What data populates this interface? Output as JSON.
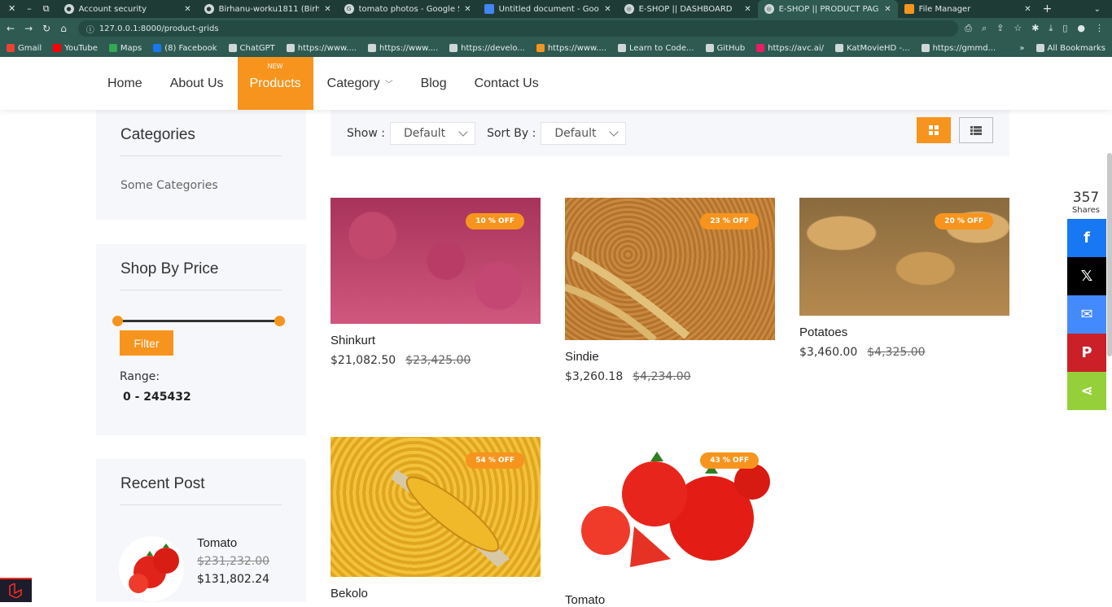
{
  "browser": {
    "tabs": [
      {
        "title": "Account security",
        "active": false
      },
      {
        "title": "Birhanu-worku1811 (Birh",
        "active": false
      },
      {
        "title": "tomato photos - Google S",
        "active": false
      },
      {
        "title": "Untitled document - Goo",
        "active": false
      },
      {
        "title": "E-SHOP || DASHBOARD",
        "active": false
      },
      {
        "title": "E-SHOP || PRODUCT PAGE",
        "active": true
      },
      {
        "title": "File Manager",
        "active": false
      }
    ],
    "url": "127.0.0.1:8000/product-grids",
    "bookmarks": [
      "Gmail",
      "YouTube",
      "Maps",
      "(8) Facebook",
      "ChatGPT",
      "https://www....",
      "https://www....",
      "https://develo...",
      "https://www....",
      "Learn to Code...",
      "GitHub",
      "https://avc.ai/",
      "KatMovieHD -...",
      "https://gmmd..."
    ],
    "all_bookmarks": "All Bookmarks"
  },
  "nav": {
    "items": [
      "Home",
      "About Us",
      "Products",
      "Category",
      "Blog",
      "Contact Us"
    ],
    "new_badge": "NEW"
  },
  "sidebar": {
    "categories_title": "Categories",
    "categories_text": "Some Categories",
    "price_title": "Shop By Price",
    "filter_label": "Filter",
    "range_label": "Range:",
    "range_value": "0  -  245432",
    "recent_title": "Recent Post",
    "recent": {
      "name": "Tomato",
      "old_price": "$231,232.00",
      "new_price": "$131,802.24"
    }
  },
  "toolbar": {
    "show_label": "Show :",
    "show_value": "Default",
    "sort_label": "Sort By :",
    "sort_value": "Default"
  },
  "products": [
    {
      "name": "Shinkurt",
      "price": "$21,082.50",
      "old": "$23,425.00",
      "badge": "10 % OFF"
    },
    {
      "name": "Sindie",
      "price": "$3,260.18",
      "old": "$4,234.00",
      "badge": "23 % OFF"
    },
    {
      "name": "Potatoes",
      "price": "$3,460.00",
      "old": "$4,325.00",
      "badge": "20 % OFF"
    },
    {
      "name": "Bekolo",
      "price": "",
      "old": "",
      "badge": "54 % OFF"
    },
    {
      "name": "Tomato",
      "price": "",
      "old": "",
      "badge": "43 % OFF"
    }
  ],
  "share": {
    "count": "357",
    "label": "Shares"
  },
  "colors": {
    "accent": "#f7941d",
    "chrome": "#2e5a52"
  }
}
